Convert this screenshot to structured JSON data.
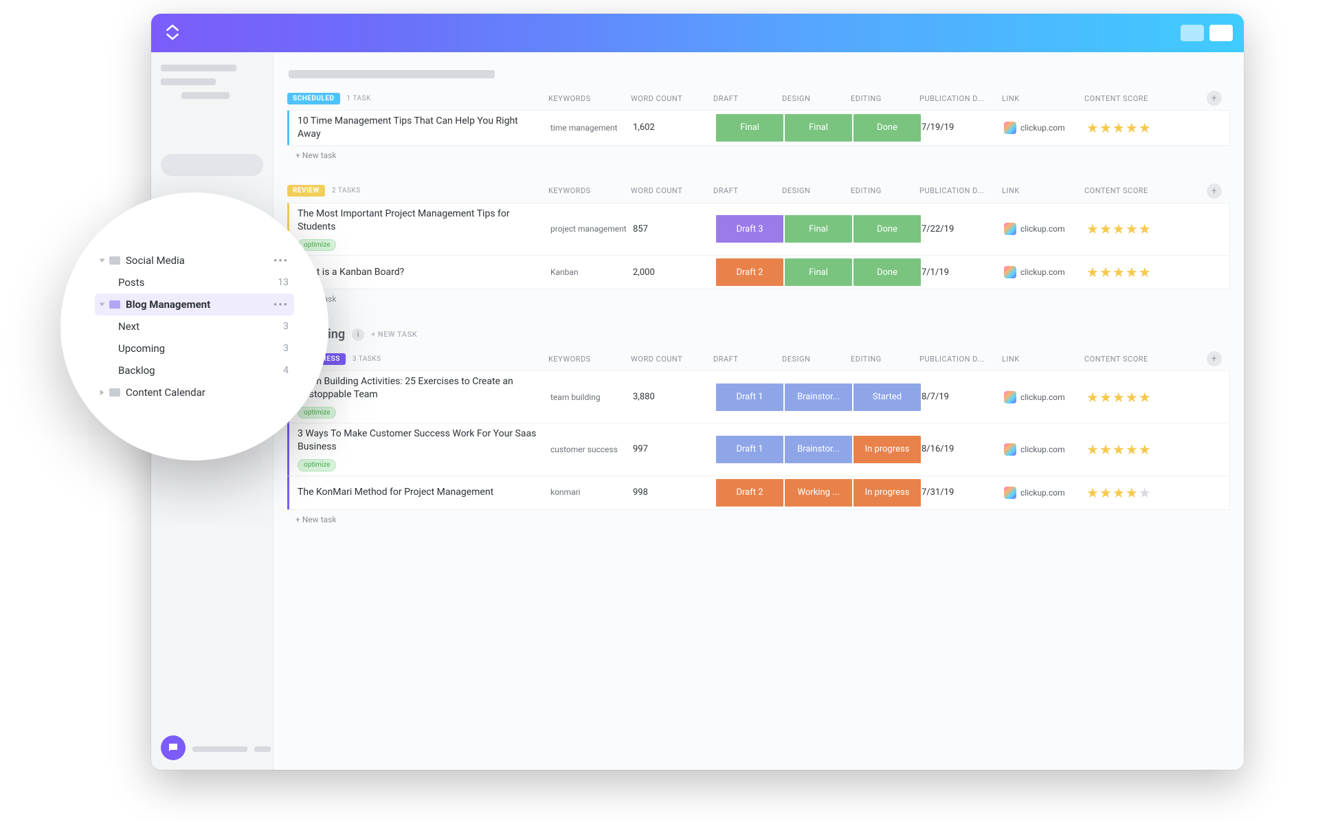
{
  "window": {},
  "columns": {
    "keywords": "KEYWORDS",
    "word_count": "WORD COUNT",
    "draft": "DRAFT",
    "design": "DESIGN",
    "editing": "EDITING",
    "pub_date": "PUBLICATION D...",
    "link": "LINK",
    "content_score": "CONTENT SCORE"
  },
  "new_task_label": "+ New task",
  "new_task_upper": "+ NEW TASK",
  "link_text": "clickup.com",
  "optimize_tag": "optimize",
  "list_heading": "Upcoming",
  "groups": [
    {
      "status_label": "SCHEDULED",
      "status_pill_class": "pill-scheduled",
      "task_count_label": "1 TASK",
      "border_color": "#4FC3F7",
      "tasks": [
        {
          "title": "10 Time Management Tips That Can Help You Right Away",
          "keywords": "time management",
          "word_count": "1,602",
          "draft": {
            "text": "Final",
            "class": "c-green"
          },
          "design": {
            "text": "Final",
            "class": "c-green"
          },
          "editing": {
            "text": "Done",
            "class": "c-green"
          },
          "pub_date": "7/19/19",
          "stars": 5,
          "optimize": false
        }
      ]
    },
    {
      "status_label": "REVIEW",
      "status_pill_class": "pill-review",
      "task_count_label": "2 TASKS",
      "border_color": "#F2CF5B",
      "tasks": [
        {
          "title": "The Most Important Project Management Tips for Students",
          "keywords": "project management",
          "word_count": "857",
          "draft": {
            "text": "Draft 3",
            "class": "c-purple"
          },
          "design": {
            "text": "Final",
            "class": "c-green"
          },
          "editing": {
            "text": "Done",
            "class": "c-green"
          },
          "pub_date": "7/22/19",
          "stars": 5,
          "optimize": true
        },
        {
          "title": "What is a Kanban Board?",
          "keywords": "Kanban",
          "word_count": "2,000",
          "draft": {
            "text": "Draft 2",
            "class": "c-orange"
          },
          "design": {
            "text": "Final",
            "class": "c-green"
          },
          "editing": {
            "text": "Done",
            "class": "c-green"
          },
          "pub_date": "7/1/19",
          "stars": 5,
          "optimize": false
        }
      ]
    },
    {
      "status_label": "IN PROGRESS",
      "status_pill_class": "pill-progress",
      "task_count_label": "3 TASKS",
      "border_color": "#7B5CFA",
      "heading_before": true,
      "tasks": [
        {
          "title": "Team Building Activities: 25 Exercises to Create an Unstoppable Team",
          "keywords": "team building",
          "word_count": "3,880",
          "draft": {
            "text": "Draft 1",
            "class": "c-blue"
          },
          "design": {
            "text": "Brainstor...",
            "class": "c-blue"
          },
          "editing": {
            "text": "Started",
            "class": "c-blue"
          },
          "pub_date": "8/7/19",
          "stars": 5,
          "optimize": true
        },
        {
          "title": "3 Ways To Make Customer Success Work For Your Saas Business",
          "keywords": "customer success",
          "word_count": "997",
          "draft": {
            "text": "Draft 1",
            "class": "c-blue"
          },
          "design": {
            "text": "Brainstor...",
            "class": "c-blue"
          },
          "editing": {
            "text": "In progress",
            "class": "c-orange"
          },
          "pub_date": "8/16/19",
          "stars": 5,
          "optimize": true
        },
        {
          "title": "The KonMari Method for Project Management",
          "keywords": "konmari",
          "word_count": "998",
          "draft": {
            "text": "Draft 2",
            "class": "c-orange"
          },
          "design": {
            "text": "Working ...",
            "class": "c-orange"
          },
          "editing": {
            "text": "In progress",
            "class": "c-orange"
          },
          "pub_date": "7/31/19",
          "stars": 4,
          "optimize": false
        }
      ]
    }
  ],
  "sidebar_tree": {
    "items": [
      {
        "type": "folder",
        "label": "Social Media",
        "expanded": true,
        "right": "dots"
      },
      {
        "type": "list",
        "label": "Posts",
        "count": "13"
      },
      {
        "type": "folder",
        "label": "Blog Management",
        "expanded": true,
        "active": true,
        "right": "dots"
      },
      {
        "type": "list",
        "label": "Next",
        "count": "3"
      },
      {
        "type": "list",
        "label": "Upcoming",
        "count": "3"
      },
      {
        "type": "list",
        "label": "Backlog",
        "count": "4"
      },
      {
        "type": "folder",
        "label": "Content Calendar",
        "expanded": false
      }
    ]
  }
}
